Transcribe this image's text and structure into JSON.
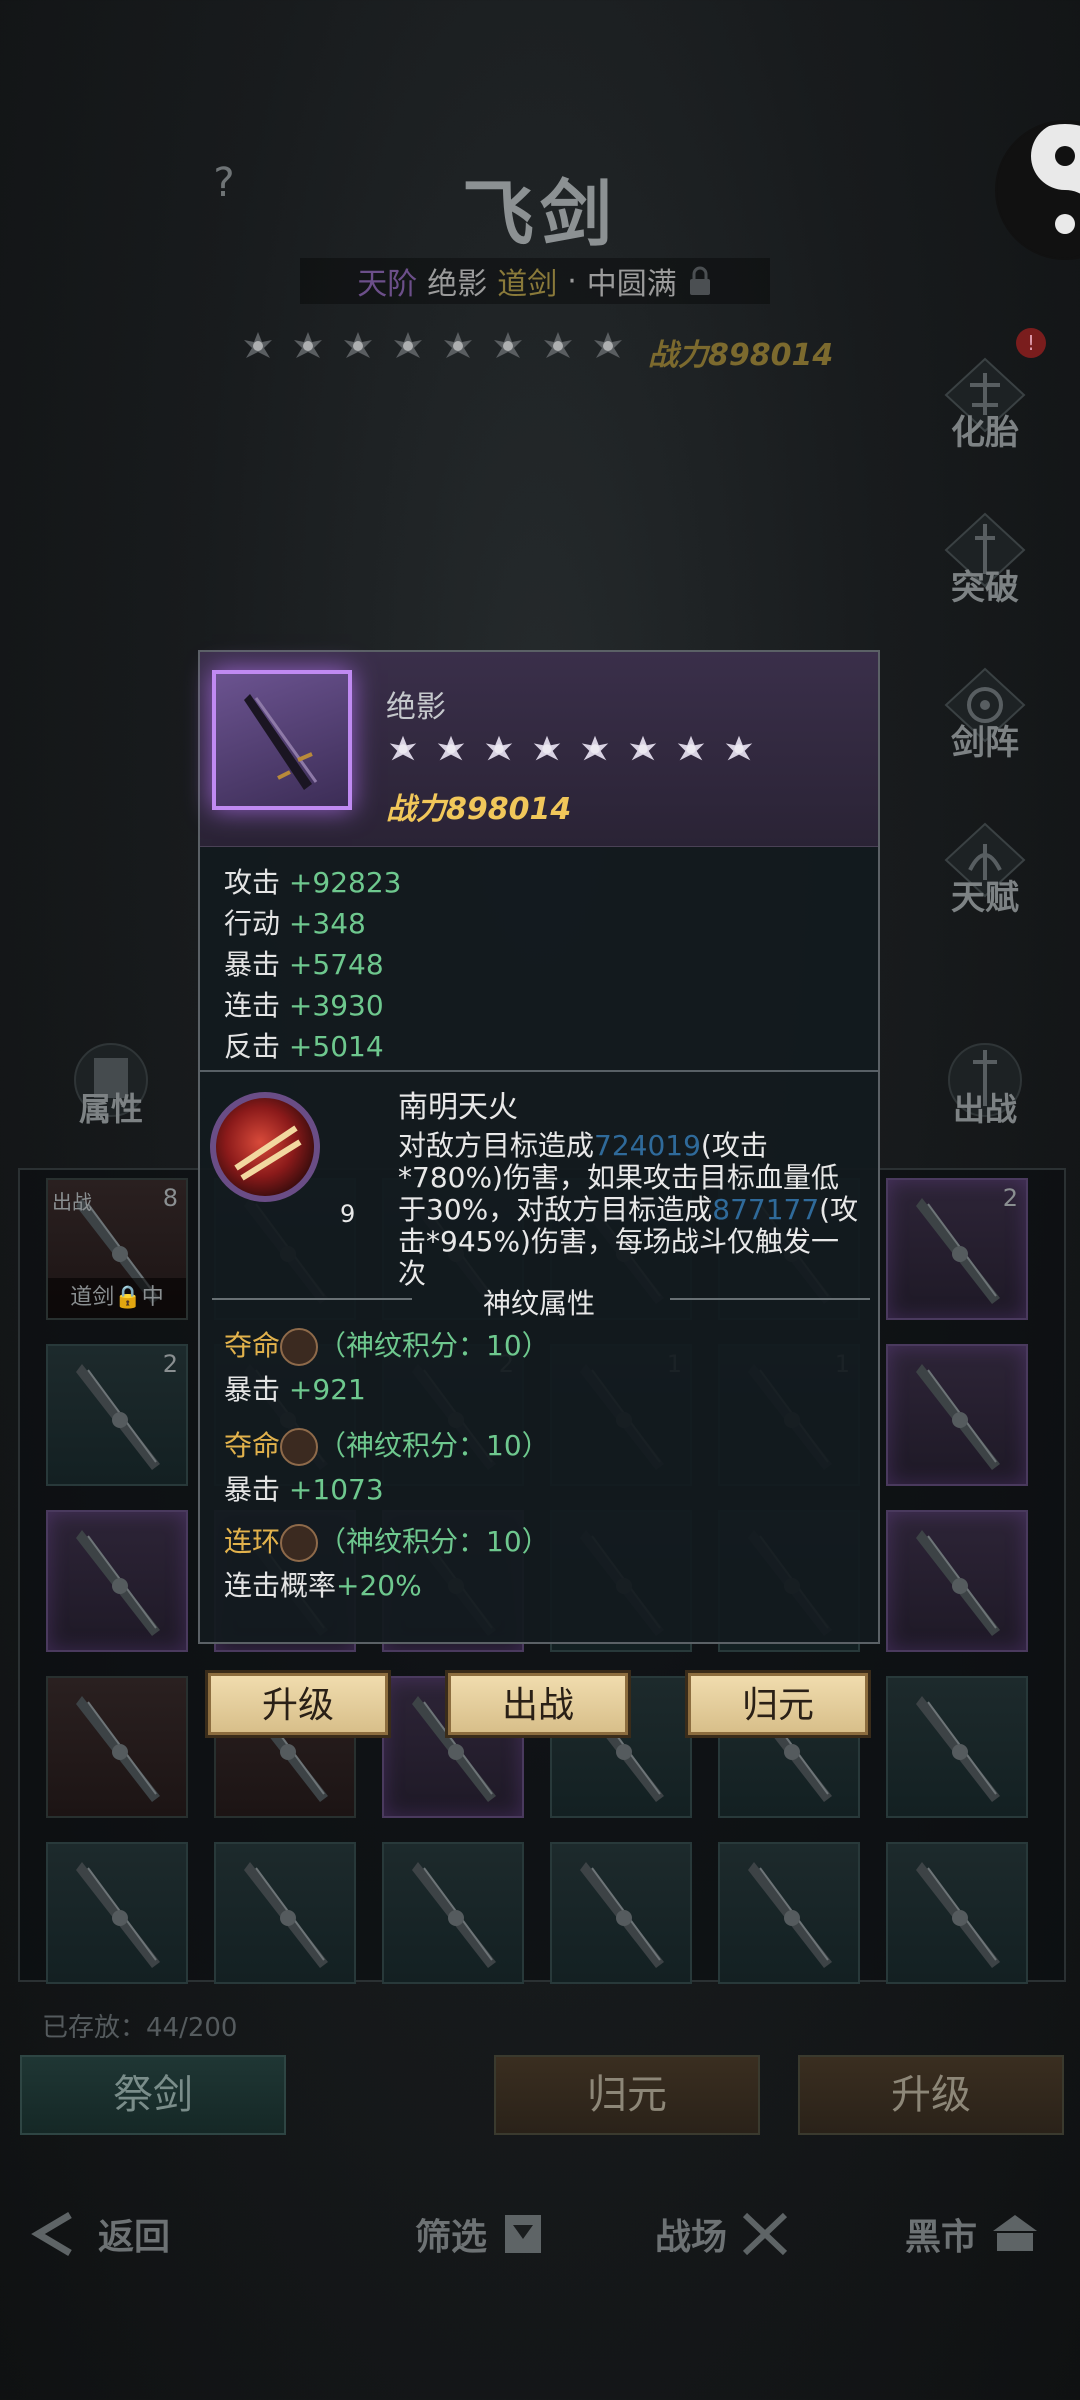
{
  "header": {
    "help": "?",
    "title": "飞剑",
    "subtitle": {
      "grade": "天阶",
      "name": "绝影",
      "type": "道剑",
      "sep": "·",
      "state": "中圆满"
    },
    "power": "战力898014",
    "badge": "!"
  },
  "right_menu": [
    "化胎",
    "突破",
    "剑阵",
    "天赋"
  ],
  "left_button": "属性",
  "deploy_button": "出战",
  "popup": {
    "name": "绝影",
    "power": "战力898014",
    "stats": [
      {
        "k": "攻击",
        "v": "+92823"
      },
      {
        "k": "行动",
        "v": "+348"
      },
      {
        "k": "暴击",
        "v": "+5748"
      },
      {
        "k": "连击",
        "v": "+3930"
      },
      {
        "k": "反击",
        "v": "+5014"
      }
    ],
    "skill": {
      "name": "南明天火",
      "level": "9",
      "desc_a": "对敌方目标造成",
      "num_a": "724019",
      "desc_b": "(攻击*780%)伤害，如果攻击目标血量低于30%，对敌方目标造成",
      "num_b": "877177",
      "desc_c": "(攻击*945%)伤害，每场战斗仅触发一次"
    },
    "rune_title": "神纹属性",
    "runes": [
      {
        "name": "夺命",
        "score": "（神纹积分：10）",
        "stat": "暴击",
        "val": "+921"
      },
      {
        "name": "夺命",
        "score": "（神纹积分：10）",
        "stat": "暴击",
        "val": "+1073"
      },
      {
        "name": "连环",
        "score": "（神纹积分：10）",
        "stat": "连击概率",
        "val": "+20%"
      }
    ],
    "buttons": [
      "升级",
      "出战",
      "归元"
    ]
  },
  "inventory": {
    "stored": "已存放：44/200",
    "cells": [
      {
        "style": "red",
        "count": "8",
        "tag": "道剑🔒中",
        "out": "出战"
      },
      {
        "style": "teal",
        "count": ""
      },
      {
        "style": "teal",
        "count": ""
      },
      {
        "style": "teal",
        "count": ""
      },
      {
        "style": "teal",
        "count": ""
      },
      {
        "style": "purple",
        "count": "2"
      },
      {
        "style": "teal",
        "count": "2"
      },
      {
        "style": "teal",
        "count": ""
      },
      {
        "style": "teal",
        "count": "2"
      },
      {
        "style": "teal",
        "count": "1"
      },
      {
        "style": "teal",
        "count": "1"
      },
      {
        "style": "purple",
        "count": ""
      },
      {
        "style": "purple",
        "count": ""
      },
      {
        "style": "purple",
        "count": ""
      },
      {
        "style": "purple",
        "count": ""
      },
      {
        "style": "teal",
        "count": ""
      },
      {
        "style": "teal",
        "count": ""
      },
      {
        "style": "purple",
        "count": ""
      },
      {
        "style": "red",
        "count": ""
      },
      {
        "style": "red",
        "count": ""
      },
      {
        "style": "purple",
        "count": ""
      },
      {
        "style": "teal",
        "count": ""
      },
      {
        "style": "teal",
        "count": ""
      },
      {
        "style": "teal",
        "count": ""
      },
      {
        "style": "teal",
        "count": ""
      },
      {
        "style": "teal",
        "count": ""
      },
      {
        "style": "teal",
        "count": ""
      },
      {
        "style": "teal",
        "count": ""
      },
      {
        "style": "teal",
        "count": ""
      },
      {
        "style": "teal",
        "count": ""
      }
    ]
  },
  "bottom_buttons": {
    "sacrifice": "祭剑",
    "restore": "归元",
    "upgrade": "升级"
  },
  "nav": {
    "back": "返回",
    "filter": "筛选",
    "arena": "战场",
    "market": "黑市"
  },
  "colors": {
    "gold": "#f1c75a",
    "green": "#6ec88e",
    "blue": "#2f6a9a",
    "purple_border": "#c08af2"
  }
}
